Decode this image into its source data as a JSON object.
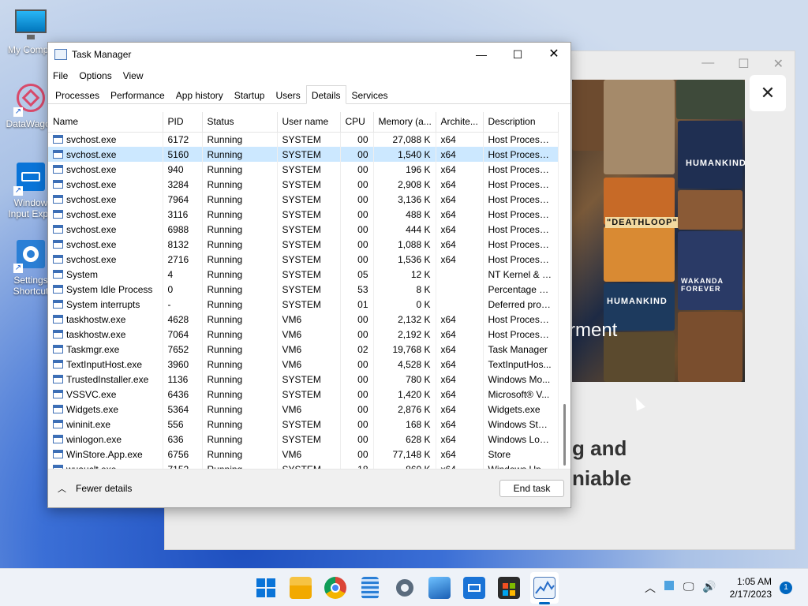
{
  "desktop": {
    "icons": [
      {
        "label": "My Compu"
      },
      {
        "label": "DataWagon"
      },
      {
        "label": "Window Input Expe"
      },
      {
        "label": "Settings Shortcut"
      }
    ]
  },
  "background_window": {
    "text_light": "rment",
    "text_line1": "g and",
    "text_line2": "niable",
    "poster_labels": [
      "HUMANKIND",
      "\"DEATHLOOP\"",
      "HUMANKIND",
      "WAKANDA FOREVER"
    ]
  },
  "task_manager": {
    "title": "Task Manager",
    "menu": [
      "File",
      "Options",
      "View"
    ],
    "tabs": [
      "Processes",
      "Performance",
      "App history",
      "Startup",
      "Users",
      "Details",
      "Services"
    ],
    "active_tab": "Details",
    "columns": [
      "Name",
      "PID",
      "Status",
      "User name",
      "CPU",
      "Memory (a...",
      "Archite...",
      "Description"
    ],
    "rows": [
      {
        "name": "svchost.exe",
        "pid": "6172",
        "status": "Running",
        "user": "SYSTEM",
        "cpu": "00",
        "mem": "27,088 K",
        "arch": "x64",
        "desc": "Host Process ..."
      },
      {
        "name": "svchost.exe",
        "pid": "5160",
        "status": "Running",
        "user": "SYSTEM",
        "cpu": "00",
        "mem": "1,540 K",
        "arch": "x64",
        "desc": "Host Process ...",
        "selected": true
      },
      {
        "name": "svchost.exe",
        "pid": "940",
        "status": "Running",
        "user": "SYSTEM",
        "cpu": "00",
        "mem": "196 K",
        "arch": "x64",
        "desc": "Host Process ..."
      },
      {
        "name": "svchost.exe",
        "pid": "3284",
        "status": "Running",
        "user": "SYSTEM",
        "cpu": "00",
        "mem": "2,908 K",
        "arch": "x64",
        "desc": "Host Process ..."
      },
      {
        "name": "svchost.exe",
        "pid": "7964",
        "status": "Running",
        "user": "SYSTEM",
        "cpu": "00",
        "mem": "3,136 K",
        "arch": "x64",
        "desc": "Host Process ..."
      },
      {
        "name": "svchost.exe",
        "pid": "3116",
        "status": "Running",
        "user": "SYSTEM",
        "cpu": "00",
        "mem": "488 K",
        "arch": "x64",
        "desc": "Host Process ..."
      },
      {
        "name": "svchost.exe",
        "pid": "6988",
        "status": "Running",
        "user": "SYSTEM",
        "cpu": "00",
        "mem": "444 K",
        "arch": "x64",
        "desc": "Host Process ..."
      },
      {
        "name": "svchost.exe",
        "pid": "8132",
        "status": "Running",
        "user": "SYSTEM",
        "cpu": "00",
        "mem": "1,088 K",
        "arch": "x64",
        "desc": "Host Process ..."
      },
      {
        "name": "svchost.exe",
        "pid": "2716",
        "status": "Running",
        "user": "SYSTEM",
        "cpu": "00",
        "mem": "1,536 K",
        "arch": "x64",
        "desc": "Host Process ..."
      },
      {
        "name": "System",
        "pid": "4",
        "status": "Running",
        "user": "SYSTEM",
        "cpu": "05",
        "mem": "12 K",
        "arch": "",
        "desc": "NT Kernel & S..."
      },
      {
        "name": "System Idle Process",
        "pid": "0",
        "status": "Running",
        "user": "SYSTEM",
        "cpu": "53",
        "mem": "8 K",
        "arch": "",
        "desc": "Percentage of..."
      },
      {
        "name": "System interrupts",
        "pid": "-",
        "status": "Running",
        "user": "SYSTEM",
        "cpu": "01",
        "mem": "0 K",
        "arch": "",
        "desc": "Deferred proc..."
      },
      {
        "name": "taskhostw.exe",
        "pid": "4628",
        "status": "Running",
        "user": "VM6",
        "cpu": "00",
        "mem": "2,132 K",
        "arch": "x64",
        "desc": "Host Process ..."
      },
      {
        "name": "taskhostw.exe",
        "pid": "7064",
        "status": "Running",
        "user": "VM6",
        "cpu": "00",
        "mem": "2,192 K",
        "arch": "x64",
        "desc": "Host Process ..."
      },
      {
        "name": "Taskmgr.exe",
        "pid": "7652",
        "status": "Running",
        "user": "VM6",
        "cpu": "02",
        "mem": "19,768 K",
        "arch": "x64",
        "desc": "Task Manager"
      },
      {
        "name": "TextInputHost.exe",
        "pid": "3960",
        "status": "Running",
        "user": "VM6",
        "cpu": "00",
        "mem": "4,528 K",
        "arch": "x64",
        "desc": "TextInputHos..."
      },
      {
        "name": "TrustedInstaller.exe",
        "pid": "1136",
        "status": "Running",
        "user": "SYSTEM",
        "cpu": "00",
        "mem": "780 K",
        "arch": "x64",
        "desc": "Windows Mo..."
      },
      {
        "name": "VSSVC.exe",
        "pid": "6436",
        "status": "Running",
        "user": "SYSTEM",
        "cpu": "00",
        "mem": "1,420 K",
        "arch": "x64",
        "desc": "Microsoft® V..."
      },
      {
        "name": "Widgets.exe",
        "pid": "5364",
        "status": "Running",
        "user": "VM6",
        "cpu": "00",
        "mem": "2,876 K",
        "arch": "x64",
        "desc": "Widgets.exe"
      },
      {
        "name": "wininit.exe",
        "pid": "556",
        "status": "Running",
        "user": "SYSTEM",
        "cpu": "00",
        "mem": "168 K",
        "arch": "x64",
        "desc": "Windows Star..."
      },
      {
        "name": "winlogon.exe",
        "pid": "636",
        "status": "Running",
        "user": "SYSTEM",
        "cpu": "00",
        "mem": "628 K",
        "arch": "x64",
        "desc": "Windows Log..."
      },
      {
        "name": "WinStore.App.exe",
        "pid": "6756",
        "status": "Running",
        "user": "VM6",
        "cpu": "00",
        "mem": "77,148 K",
        "arch": "x64",
        "desc": "Store"
      },
      {
        "name": "wuauclt.exe",
        "pid": "7152",
        "status": "Running",
        "user": "SYSTEM",
        "cpu": "18",
        "mem": "860 K",
        "arch": "x64",
        "desc": "Windows Up..."
      }
    ],
    "footer": {
      "fewer_details": "Fewer details",
      "end_task": "End task"
    }
  },
  "taskbar": {
    "time": "1:05 AM",
    "date": "2/17/2023",
    "notification_count": "1",
    "icons": [
      "start-icon",
      "file-explorer-icon",
      "chrome-icon",
      "notepad-icon",
      "settings-icon",
      "photos-icon",
      "keyboard-icon",
      "store-icon",
      "task-manager-icon"
    ]
  },
  "colors": {
    "selection": "#cce8ff",
    "accent": "#0067c0"
  }
}
